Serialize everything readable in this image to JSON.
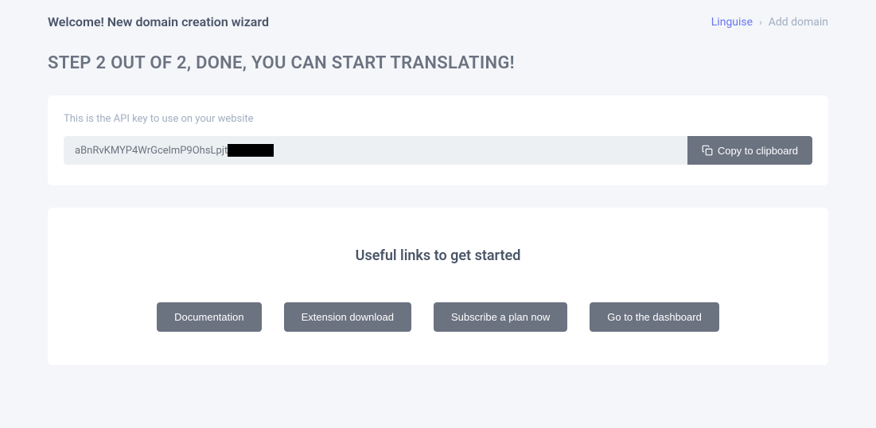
{
  "header": {
    "welcome_title": "Welcome! New domain creation wizard"
  },
  "breadcrumb": {
    "link": "Linguise",
    "separator": "›",
    "current": "Add domain"
  },
  "step_heading": "STEP 2 OUT OF 2, DONE, YOU CAN START TRANSLATING!",
  "api_section": {
    "label": "This is the API key to use on your website",
    "key_value": "aBnRvKMYP4WrGcelmP9OhsLpjt",
    "copy_button": "Copy to clipboard"
  },
  "links_section": {
    "heading": "Useful links to get started",
    "buttons": {
      "documentation": "Documentation",
      "extension": "Extension download",
      "subscribe": "Subscribe a plan now",
      "dashboard": "Go to the dashboard"
    }
  }
}
